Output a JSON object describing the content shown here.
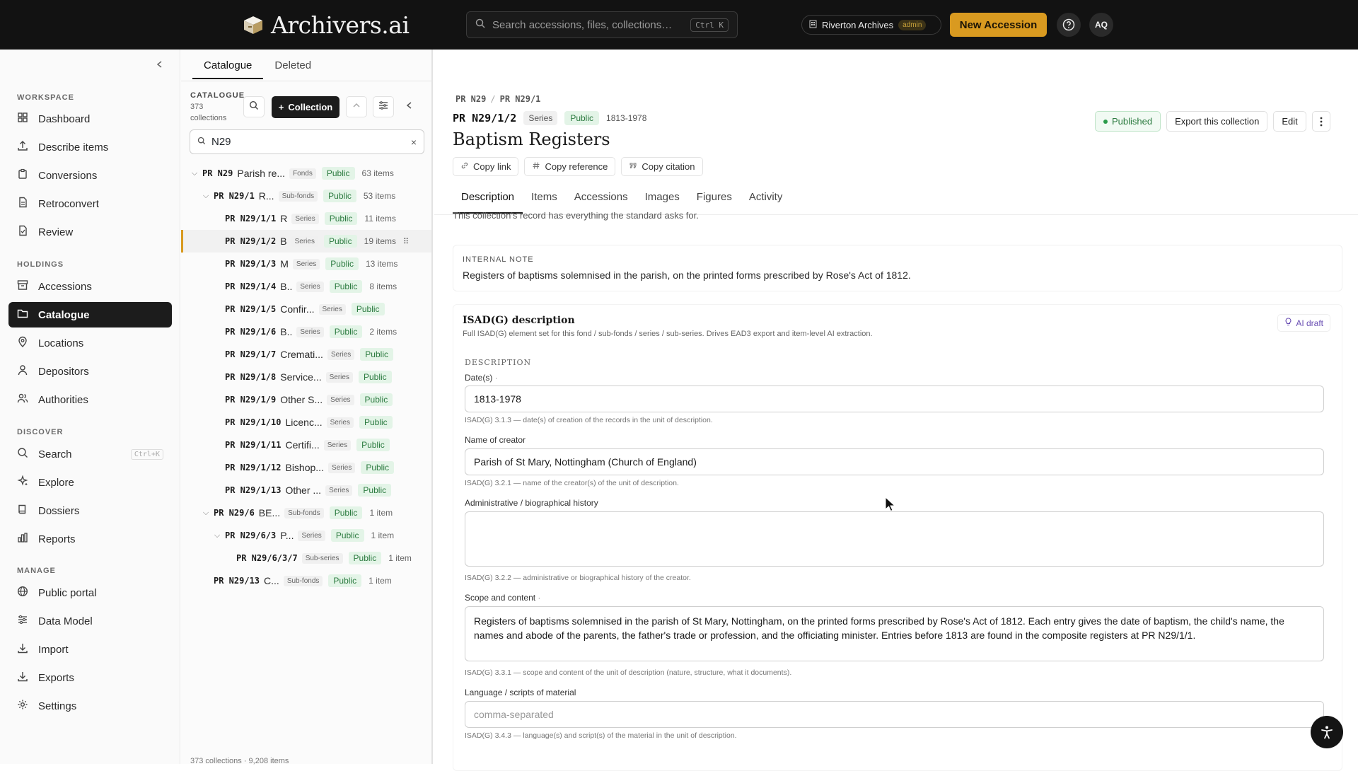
{
  "app": {
    "name": "Archivers.ai",
    "search_placeholder": "Search accessions, files, collections…",
    "search_shortcut": "Ctrl K",
    "org": "Riverton Archives",
    "org_role": "admin",
    "new_accession": "New Accession",
    "user_initials": "AQ"
  },
  "sidebar": {
    "sections": [
      {
        "label": "WORKSPACE",
        "items": [
          {
            "label": "Dashboard",
            "icon": "grid-icon"
          },
          {
            "label": "Describe items",
            "icon": "upload-icon"
          },
          {
            "label": "Conversions",
            "icon": "clipboard-icon"
          },
          {
            "label": "Retroconvert",
            "icon": "file-icon"
          },
          {
            "label": "Review",
            "icon": "file-check-icon"
          }
        ]
      },
      {
        "label": "HOLDINGS",
        "items": [
          {
            "label": "Accessions",
            "icon": "archive-icon"
          },
          {
            "label": "Catalogue",
            "icon": "folder-icon"
          },
          {
            "label": "Locations",
            "icon": "pin-icon"
          },
          {
            "label": "Depositors",
            "icon": "user-icon"
          },
          {
            "label": "Authorities",
            "icon": "users-icon"
          }
        ]
      },
      {
        "label": "DISCOVER",
        "items": [
          {
            "label": "Search",
            "icon": "search-icon",
            "shortcut": "Ctrl+K"
          },
          {
            "label": "Explore",
            "icon": "sparkle-icon"
          },
          {
            "label": "Dossiers",
            "icon": "book-icon"
          },
          {
            "label": "Reports",
            "icon": "bar-chart-icon"
          }
        ]
      },
      {
        "label": "MANAGE",
        "items": [
          {
            "label": "Public portal",
            "icon": "globe-icon"
          },
          {
            "label": "Data Model",
            "icon": "sliders-icon"
          },
          {
            "label": "Import",
            "icon": "download-icon"
          },
          {
            "label": "Exports",
            "icon": "download-icon"
          },
          {
            "label": "Settings",
            "icon": "gear-icon"
          }
        ]
      }
    ],
    "active": "Catalogue"
  },
  "tree": {
    "tabs": [
      "Catalogue",
      "Deleted"
    ],
    "heading": "CATALOGUE",
    "count_line1": "373",
    "count_line2": "collections",
    "collection_button": "Collection",
    "search_value": "N29",
    "footer": "373 collections · 9,208 items",
    "rows": [
      {
        "depth": 0,
        "chev": "down",
        "ref": "PR N29",
        "name": "Parish re...",
        "level": "Fonds",
        "status": "Public",
        "count": "63 items"
      },
      {
        "depth": 1,
        "chev": "down",
        "ref": "PR N29/1",
        "name": "R...",
        "level": "Sub-fonds",
        "status": "Public",
        "count": "53 items"
      },
      {
        "depth": 2,
        "chev": "",
        "ref": "PR N29/1/1",
        "name": "R",
        "level": "Series",
        "status": "Public",
        "count": "11 items"
      },
      {
        "depth": 2,
        "chev": "",
        "ref": "PR N29/1/2",
        "name": "B",
        "level": "Series",
        "status": "Public",
        "count": "19 items",
        "selected": true
      },
      {
        "depth": 2,
        "chev": "",
        "ref": "PR N29/1/3",
        "name": "M",
        "level": "Series",
        "status": "Public",
        "count": "13 items"
      },
      {
        "depth": 2,
        "chev": "",
        "ref": "PR N29/1/4",
        "name": "B..",
        "level": "Series",
        "status": "Public",
        "count": "8 items"
      },
      {
        "depth": 2,
        "chev": "",
        "ref": "PR N29/1/5",
        "name": "Confir...",
        "level": "Series",
        "status": "Public",
        "count": ""
      },
      {
        "depth": 2,
        "chev": "",
        "ref": "PR N29/1/6",
        "name": "B..",
        "level": "Series",
        "status": "Public",
        "count": "2 items"
      },
      {
        "depth": 2,
        "chev": "",
        "ref": "PR N29/1/7",
        "name": "Cremati...",
        "level": "Series",
        "status": "Public",
        "count": ""
      },
      {
        "depth": 2,
        "chev": "",
        "ref": "PR N29/1/8",
        "name": "Service...",
        "level": "Series",
        "status": "Public",
        "count": ""
      },
      {
        "depth": 2,
        "chev": "",
        "ref": "PR N29/1/9",
        "name": "Other S...",
        "level": "Series",
        "status": "Public",
        "count": ""
      },
      {
        "depth": 2,
        "chev": "",
        "ref": "PR N29/1/10",
        "name": "Licenc...",
        "level": "Series",
        "status": "Public",
        "count": ""
      },
      {
        "depth": 2,
        "chev": "",
        "ref": "PR N29/1/11",
        "name": "Certifi...",
        "level": "Series",
        "status": "Public",
        "count": ""
      },
      {
        "depth": 2,
        "chev": "",
        "ref": "PR N29/1/12",
        "name": "Bishop...",
        "level": "Series",
        "status": "Public",
        "count": ""
      },
      {
        "depth": 2,
        "chev": "",
        "ref": "PR N29/1/13",
        "name": "Other ...",
        "level": "Series",
        "status": "Public",
        "count": ""
      },
      {
        "depth": 1,
        "chev": "down",
        "ref": "PR N29/6",
        "name": "BE...",
        "level": "Sub-fonds",
        "status": "Public",
        "count": "1 item"
      },
      {
        "depth": 2,
        "chev": "down",
        "ref": "PR N29/6/3",
        "name": "P...",
        "level": "Series",
        "status": "Public",
        "count": "1 item"
      },
      {
        "depth": 3,
        "chev": "",
        "ref": "PR N29/6/3/7",
        "name": "",
        "level": "Sub-series",
        "status": "Public",
        "count": "1 item"
      },
      {
        "depth": 1,
        "chev": "",
        "ref": "PR N29/13",
        "name": "C...",
        "level": "Sub-fonds",
        "status": "Public",
        "count": "1 item"
      }
    ]
  },
  "record": {
    "crumbs": [
      "PR N29",
      "PR N29/1"
    ],
    "ref": "PR N29/1/2",
    "level": "Series",
    "status": "Public",
    "dates": "1813-1978",
    "title": "Baptism Registers",
    "published": "Published",
    "export": "Export this collection",
    "edit": "Edit",
    "copy_link": "Copy link",
    "copy_reference": "Copy reference",
    "copy_citation": "Copy citation",
    "tabs": [
      "Description",
      "Items",
      "Accessions",
      "Images",
      "Figures",
      "Activity"
    ],
    "standard_note": "This collection's record has everything the standard asks for.",
    "internal_note_label": "INTERNAL NOTE",
    "internal_note": "Registers of baptisms solemnised in the parish, on the printed forms prescribed by Rose's Act of 1812.",
    "isad_title": "ISAD(G) description",
    "isad_sub": "Full ISAD(G) element set for this fond / sub-fonds / series / sub-series. Drives EAD3 export and item-level AI extraction.",
    "ai_draft": "AI draft",
    "desc_label": "DESCRIPTION",
    "fields": {
      "dates_label": "Date(s)",
      "dates_value": "1813-1978",
      "dates_hint": "ISAD(G) 3.1.3 — date(s) of creation of the records in the unit of description.",
      "creator_label": "Name of creator",
      "creator_value": "Parish of St Mary, Nottingham (Church of England)",
      "creator_hint": "ISAD(G) 3.2.1 — name of the creator(s) of the unit of description.",
      "admin_label": "Administrative / biographical history",
      "admin_value": "",
      "admin_hint": "ISAD(G) 3.2.2 — administrative or biographical history of the creator.",
      "scope_label": "Scope and content",
      "scope_value": "Registers of baptisms solemnised in the parish of St Mary, Nottingham, on the printed forms prescribed by Rose's Act of 1812. Each entry gives the date of baptism, the child's name, the names and abode of the parents, the father's trade or profession, and the officiating minister. Entries before 1813 are found in the composite registers at PR N29/1/1.",
      "scope_hint": "ISAD(G) 3.3.1 — scope and content of the unit of description (nature, structure, what it documents).",
      "lang_label": "Language / scripts of material",
      "lang_placeholder": "comma-separated",
      "lang_hint": "ISAD(G) 3.4.3 — language(s) and script(s) of the material in the unit of description."
    }
  },
  "colors": {
    "accent": "#d99a20",
    "public_green": "#2b7a3f",
    "dark": "#121212"
  }
}
